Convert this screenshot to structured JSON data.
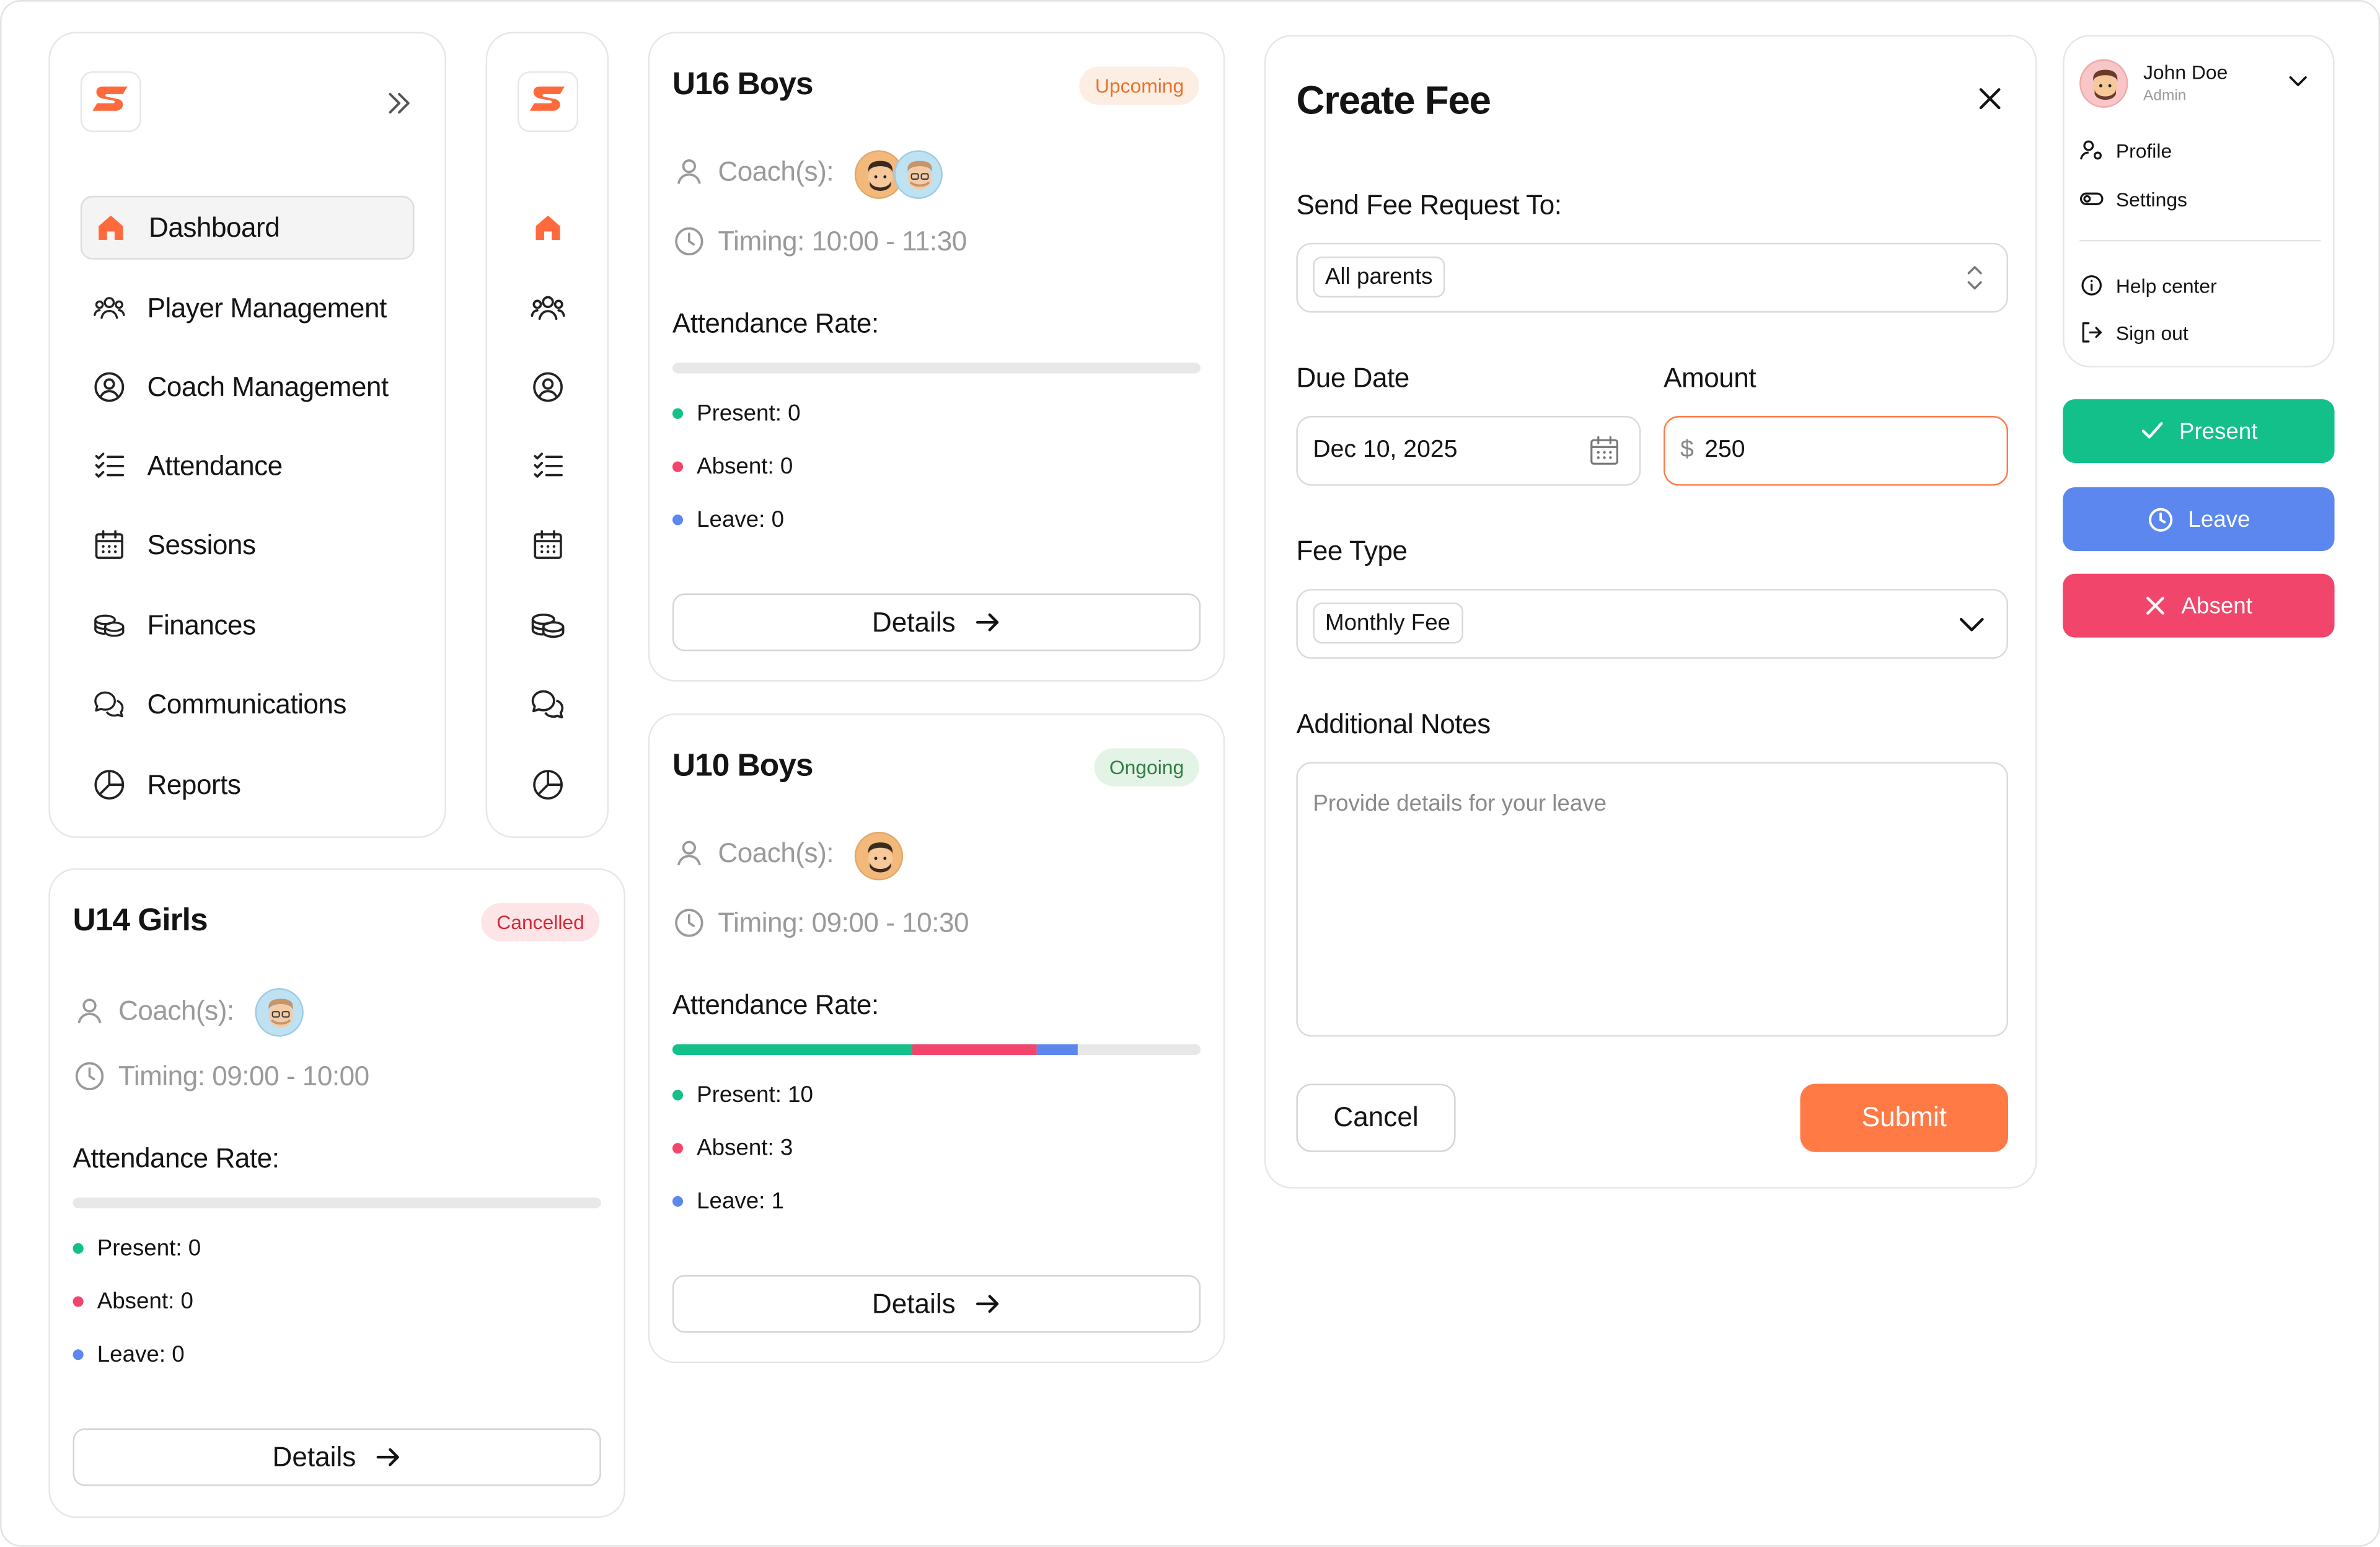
{
  "colors": {
    "accent": "#ff7a45",
    "present": "#13c08a",
    "absent": "#f2456b",
    "leave": "#5b87ee"
  },
  "nav": {
    "items": [
      {
        "label": "Dashboard",
        "icon": "home-icon"
      },
      {
        "label": "Player Management",
        "icon": "players-icon"
      },
      {
        "label": "Coach Management",
        "icon": "coach-icon"
      },
      {
        "label": "Attendance",
        "icon": "checklist-icon"
      },
      {
        "label": "Sessions",
        "icon": "calendar-icon"
      },
      {
        "label": "Finances",
        "icon": "coins-icon"
      },
      {
        "label": "Communications",
        "icon": "chat-icon"
      },
      {
        "label": "Reports",
        "icon": "pie-chart-icon"
      }
    ]
  },
  "sessions": [
    {
      "title": "U16 Boys",
      "status": "Upcoming",
      "coach_label": "Coach(s):",
      "timing": "Timing: 10:00 - 11:30",
      "attendance_label": "Attendance Rate:",
      "present": "Present: 0",
      "absent": "Absent: 0",
      "leave": "Leave: 0",
      "progress": {
        "present_frac": 0,
        "absent_frac": 0,
        "leave_frac": 0
      },
      "details": "Details"
    },
    {
      "title": "U10 Boys",
      "status": "Ongoing",
      "coach_label": "Coach(s):",
      "timing": "Timing: 09:00 - 10:30",
      "attendance_label": "Attendance Rate:",
      "present": "Present: 10",
      "absent": "Absent: 3",
      "leave": "Leave: 1",
      "progress": {
        "present_frac": 0.455,
        "absent_frac": 0.235,
        "leave_frac": 0.077
      },
      "details": "Details"
    },
    {
      "title": "U14 Girls",
      "status": "Cancelled",
      "coach_label": "Coach(s):",
      "timing": "Timing: 09:00 - 10:00",
      "attendance_label": "Attendance Rate:",
      "present": "Present: 0",
      "absent": "Absent: 0",
      "leave": "Leave: 0",
      "progress": {
        "present_frac": 0,
        "absent_frac": 0,
        "leave_frac": 0
      },
      "details": "Details"
    }
  ],
  "fee_form": {
    "title": "Create Fee",
    "send_to_label": "Send Fee Request To:",
    "send_to_value": "All parents",
    "due_date_label": "Due Date",
    "due_date_value": "Dec 10, 2025",
    "amount_label": "Amount",
    "currency": "$",
    "amount_value": "250",
    "fee_type_label": "Fee Type",
    "fee_type_value": "Monthly Fee",
    "notes_label": "Additional Notes",
    "notes_placeholder": "Provide details for your leave",
    "cancel": "Cancel",
    "submit": "Submit"
  },
  "user_menu": {
    "name": "John Doe",
    "role": "Admin",
    "items": [
      "Profile",
      "Settings",
      "Help center",
      "Sign out"
    ]
  },
  "actions": {
    "present": "Present",
    "leave": "Leave",
    "absent": "Absent"
  }
}
